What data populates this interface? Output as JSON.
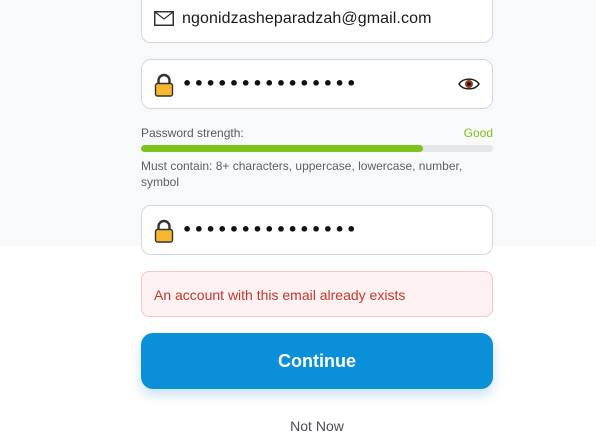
{
  "email_field": {
    "icon": "mail-icon",
    "value": "ngonidzasheparadzah@gmail.com"
  },
  "password_field": {
    "icon": "lock-icon",
    "value": "•••••••••••••••",
    "toggle_icon": "eye-icon"
  },
  "password_strength": {
    "label": "Password strength:",
    "value": "Good",
    "level_percent": 80,
    "color": "#7cc21a",
    "hint": "Must contain: 8+ characters, uppercase, lowercase, number, symbol"
  },
  "confirm_password_field": {
    "icon": "lock-icon",
    "value": "•••••••••••••••"
  },
  "error": {
    "message": "An account with this email already exists",
    "color": "#c7372f"
  },
  "actions": {
    "continue_label": "Continue",
    "not_now_label": "Not Now"
  },
  "colors": {
    "primary": "#0a90d8",
    "strength_good": "#7cc21a",
    "error": "#c7372f"
  }
}
